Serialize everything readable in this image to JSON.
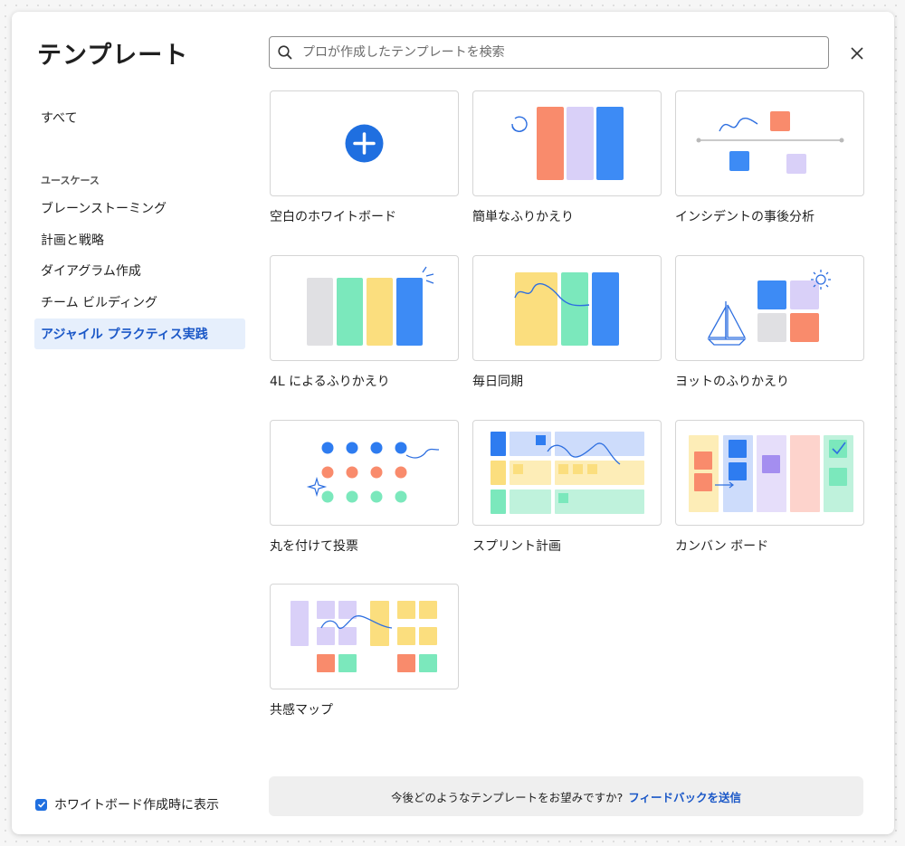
{
  "header": {
    "title": "テンプレート",
    "search_placeholder": "プロが作成したテンプレートを検索",
    "close_icon": "close-icon"
  },
  "sidebar": {
    "all_label": "すべて",
    "section_label": "ユースケース",
    "items": [
      {
        "label": "ブレーンストーミング",
        "active": false
      },
      {
        "label": "計画と戦略",
        "active": false
      },
      {
        "label": "ダイアグラム作成",
        "active": false
      },
      {
        "label": "チーム ビルディング",
        "active": false
      },
      {
        "label": "アジャイル プラクティス実践",
        "active": true
      }
    ]
  },
  "templates": [
    {
      "label": "空白のホワイトボード",
      "icon": "plus-icon"
    },
    {
      "label": "簡単なふりかえり",
      "icon": "retro-columns-icon"
    },
    {
      "label": "インシデントの事後分析",
      "icon": "timeline-icon"
    },
    {
      "label": "4L によるふりかえり",
      "icon": "four-columns-icon"
    },
    {
      "label": "毎日同期",
      "icon": "daily-sync-icon"
    },
    {
      "label": "ヨットのふりかえり",
      "icon": "sailboat-icon"
    },
    {
      "label": "丸を付けて投票",
      "icon": "dot-vote-icon"
    },
    {
      "label": "スプリント計画",
      "icon": "sprint-grid-icon"
    },
    {
      "label": "カンバン ボード",
      "icon": "kanban-icon"
    },
    {
      "label": "共感マップ",
      "icon": "empathy-map-icon"
    }
  ],
  "footer": {
    "checkbox_label": "ホワイトボード作成時に表示",
    "checkbox_checked": true,
    "feedback_text": "今後どのようなテンプレートをお望みですか?",
    "feedback_link": "フィードバックを送信"
  },
  "colors": {
    "accent_blue": "#1f6fe0",
    "active_bg": "#e6effc",
    "salmon": "#f98b6c",
    "lavender": "#d9d0f8",
    "blue": "#3d8bf5",
    "mint": "#7be8bc",
    "yellow": "#fbde7e",
    "grey": "#e0e0e3"
  }
}
